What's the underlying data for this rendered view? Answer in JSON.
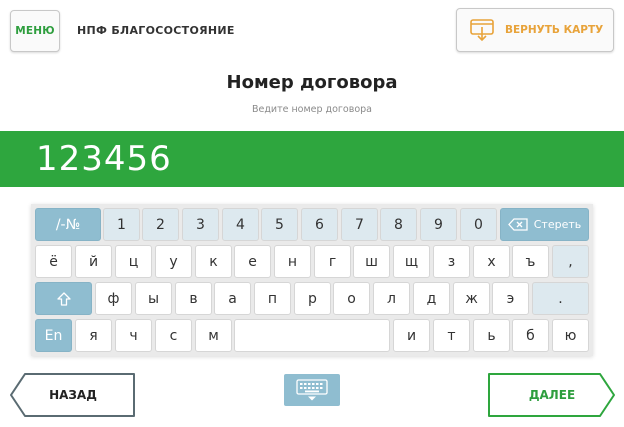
{
  "header": {
    "menu_label": "МЕНЮ",
    "org_name": "НПФ БЛАГОСОСТОЯНИЕ",
    "return_card_label": "ВЕРНУТЬ КАРТУ"
  },
  "form": {
    "title": "Номер договора",
    "subtitle": "Ведите номер договора",
    "input_value": "123456"
  },
  "keyboard": {
    "symbols_key": "/-№",
    "digits": [
      "1",
      "2",
      "3",
      "4",
      "5",
      "6",
      "7",
      "8",
      "9",
      "0"
    ],
    "erase_label": "Стереть",
    "row2": [
      "ё",
      "й",
      "ц",
      "у",
      "к",
      "е",
      "н",
      "г",
      "ш",
      "щ",
      "з",
      "х",
      "ъ"
    ],
    "row2_punct": ",",
    "row3": [
      "ф",
      "ы",
      "в",
      "а",
      "п",
      "р",
      "о",
      "л",
      "д",
      "ж",
      "э"
    ],
    "row3_punct": ".",
    "lang_key": "En",
    "row4_left": [
      "я",
      "ч",
      "с",
      "м"
    ],
    "row4_right": [
      "и",
      "т",
      "ь",
      "б",
      "ю"
    ]
  },
  "footer": {
    "back_label": "НАЗАД",
    "next_label": "ДАЛЕЕ"
  },
  "colors": {
    "accent_green": "#2ea63e",
    "orange": "#e8a33a",
    "key_blue": "#8fbdd0",
    "key_light": "#dde9ef"
  },
  "icons": {
    "return_card": "card-eject-icon",
    "erase": "backspace-icon",
    "shift": "shift-arrow-icon",
    "keyboard": "keyboard-icon"
  }
}
